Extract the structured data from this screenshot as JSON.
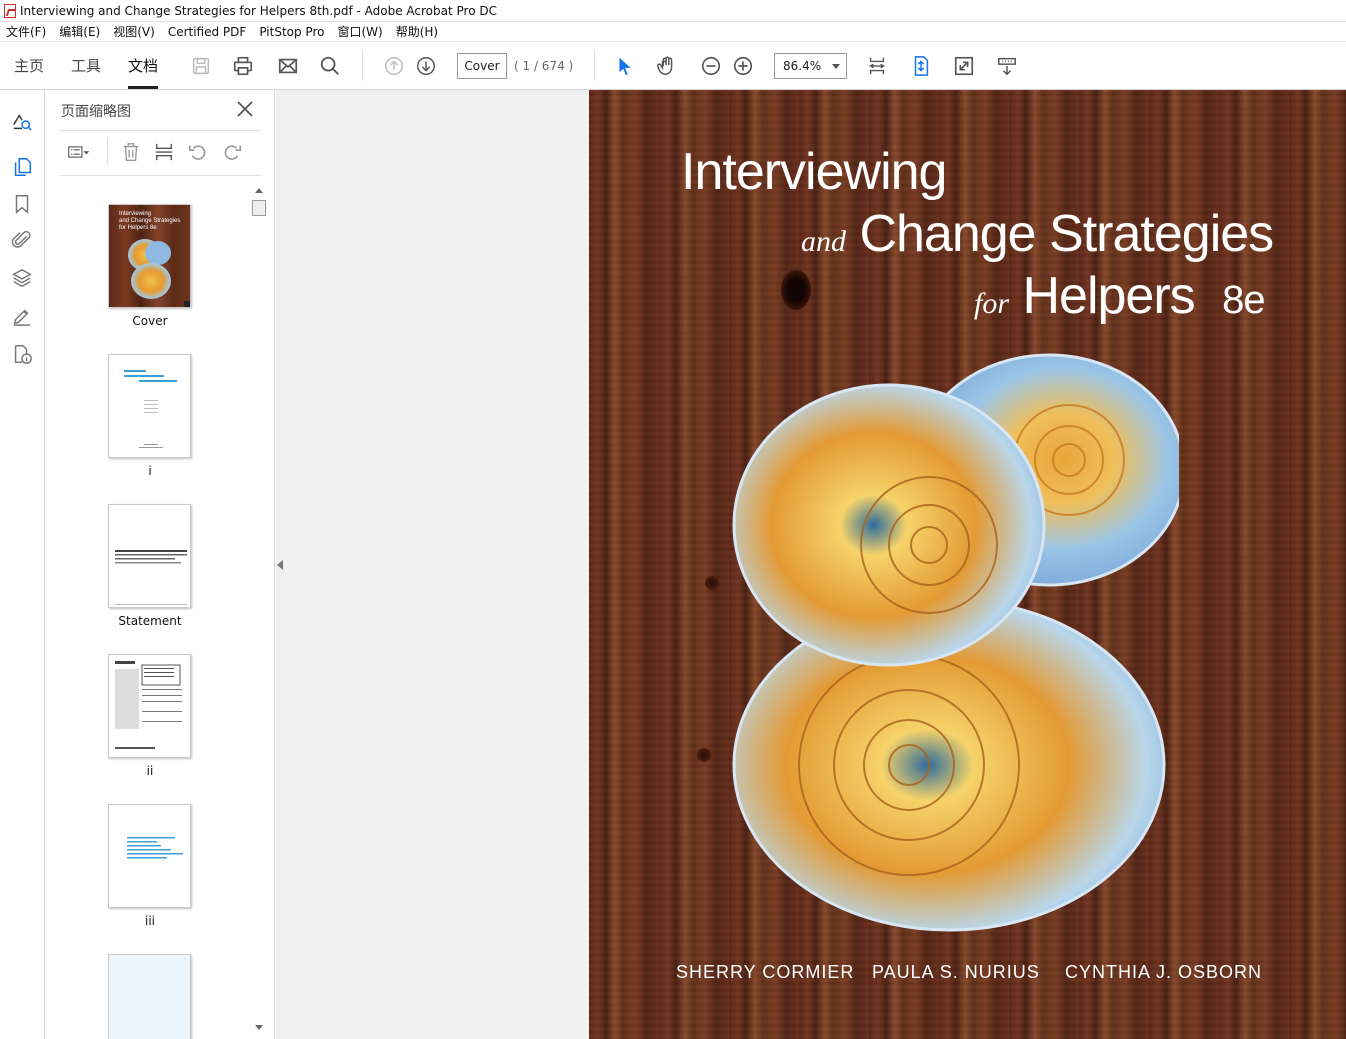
{
  "window": {
    "title": "Interviewing and Change Strategies for Helpers 8th.pdf - Adobe Acrobat Pro DC"
  },
  "menubar": {
    "items": [
      "文件(F)",
      "编辑(E)",
      "视图(V)",
      "Certified PDF",
      "PitStop Pro",
      "窗口(W)",
      "帮助(H)"
    ]
  },
  "toolbar": {
    "tabs": [
      "主页",
      "工具",
      "文档"
    ],
    "active_tab": "文档",
    "page_field_value": "Cover",
    "page_count": "( 1 / 674 )",
    "zoom_value": "86.4%"
  },
  "thumbnail_panel": {
    "title": "页面缩略图",
    "thumbnails": [
      {
        "label": "Cover"
      },
      {
        "label": "i"
      },
      {
        "label": "Statement"
      },
      {
        "label": "ii"
      },
      {
        "label": "iii"
      }
    ]
  },
  "cover": {
    "title_line1": "Interviewing",
    "title_line2_prefix": "and",
    "title_line2": "Change Strategies",
    "title_line3_prefix": "for",
    "title_line3": "Helpers",
    "edition": "8e",
    "authors": [
      "SHERRY CORMIER",
      "PAULA S. NURIUS",
      "CYNTHIA J. OSBORN"
    ]
  },
  "thumb_cover_text": {
    "line1": "Interviewing",
    "line2": "and Change Strategies",
    "line3": "for Helpers 8e"
  },
  "colors": {
    "accent": "#1473e6",
    "wood": "#6b3019"
  }
}
